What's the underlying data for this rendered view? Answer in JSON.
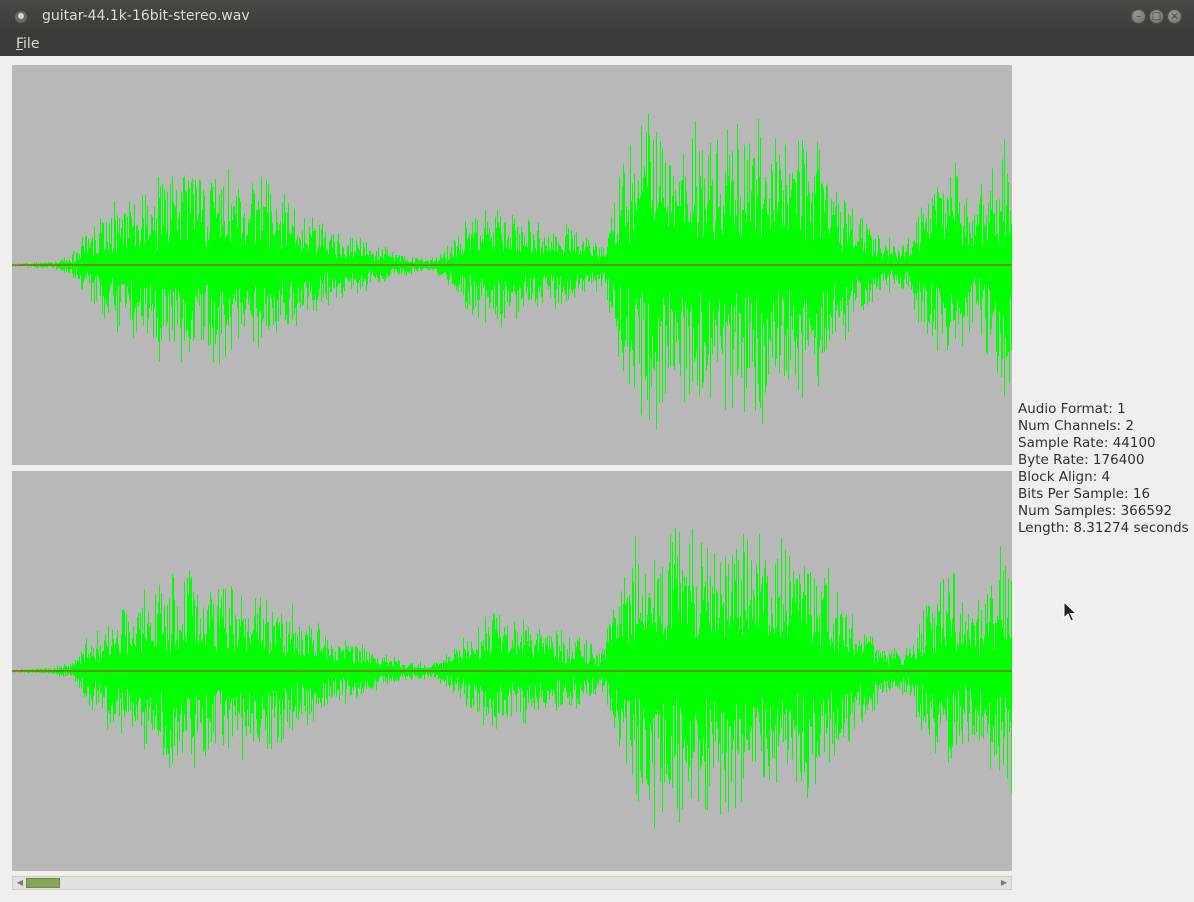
{
  "window": {
    "title": "guitar-44.1k-16bit-stereo.wav",
    "controls": [
      "minimize-icon",
      "maximize-icon",
      "close-icon"
    ]
  },
  "menu": {
    "file": "File"
  },
  "info": {
    "audio_format": "Audio Format: 1",
    "num_channels": "Num Channels: 2",
    "sample_rate": "Sample Rate: 44100",
    "byte_rate": "Byte Rate: 176400",
    "block_align": "Block Align: 4",
    "bits_per_sample": "Bits Per Sample: 16",
    "num_samples": "Num Samples: 366592",
    "length": "Length: 8.31274 seconds"
  },
  "waveform": {
    "background": "#b8b8b8",
    "wave_color": "#00ff00",
    "center_line_color": "#cc2200",
    "channels": [
      "left",
      "right"
    ]
  },
  "scrollbar": {
    "position": 0.0,
    "thumb_color": "#87a556"
  }
}
